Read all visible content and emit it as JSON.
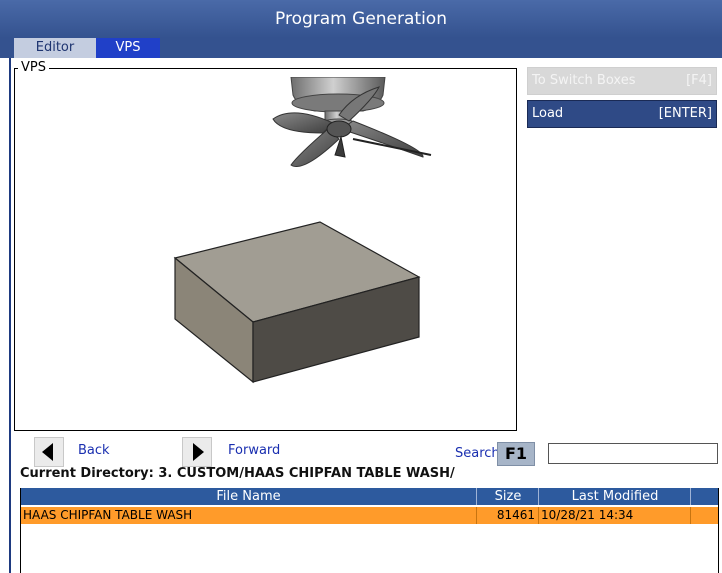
{
  "window": {
    "title": "Program Generation"
  },
  "tabs": [
    {
      "label": "Editor",
      "active": false
    },
    {
      "label": "VPS",
      "active": true
    }
  ],
  "vps_panel": {
    "legend": "VPS"
  },
  "side_buttons": {
    "switch": {
      "label": "To Switch Boxes",
      "key": "[F4]",
      "enabled": false
    },
    "load": {
      "label": "Load",
      "key": "[ENTER]",
      "enabled": true
    }
  },
  "navigation": {
    "back_label": "Back",
    "forward_label": "Forward",
    "search_label": "Search",
    "search_key": "F1",
    "search_value": ""
  },
  "current_directory": "Current Directory: 3. CUSTOM/HAAS CHIPFAN TABLE WASH/",
  "file_table": {
    "columns": [
      "File Name",
      "Size",
      "Last Modified"
    ],
    "rows": [
      {
        "name": "HAAS CHIPFAN TABLE WASH",
        "size": "81461",
        "modified": "10/28/21 14:34",
        "selected": true
      }
    ]
  },
  "colors": {
    "title_bar": "#34528f",
    "active_tab": "#2040c8",
    "table_header": "#2d5a9e",
    "selected_row": "#ff9b2a",
    "link_text": "#1a2fb0"
  },
  "icons": {
    "back": "back-arrow-icon",
    "forward": "forward-arrow-icon"
  }
}
